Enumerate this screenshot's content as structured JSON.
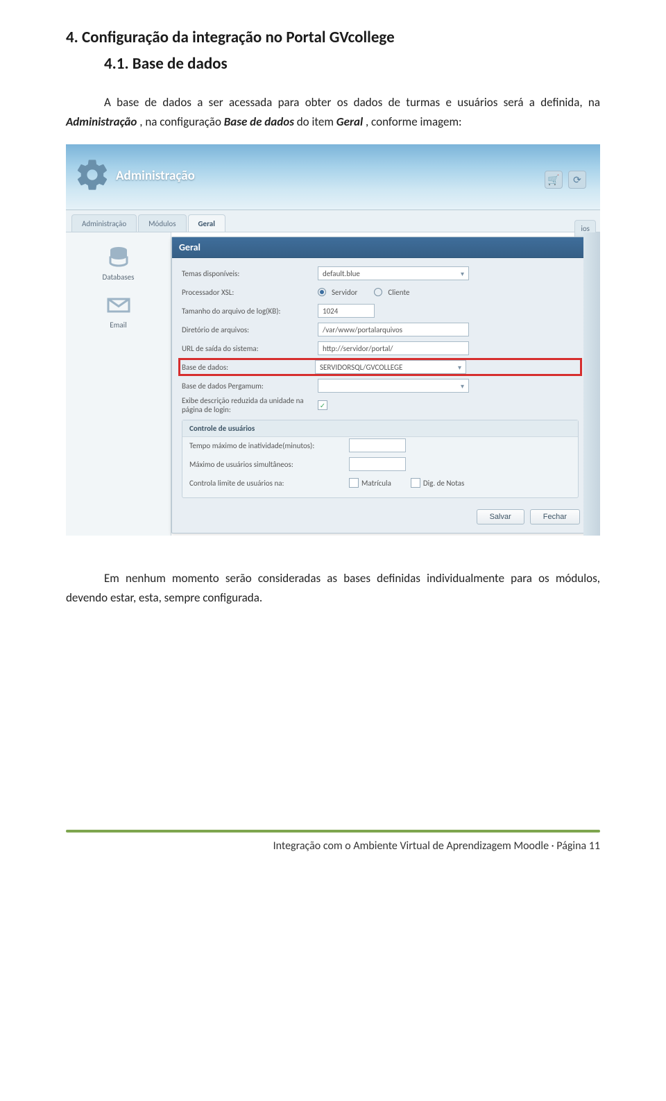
{
  "doc": {
    "h1": "4. Configuração da integração no Portal GVcollege",
    "h2": "4.1. Base de dados",
    "p1_a": "A base de dados a ser acessada para obter os dados de turmas e usuários será a definida, na ",
    "p1_admin": "Administração",
    "p1_b": ", na configuração ",
    "p1_base": "Base de dados",
    "p1_c": " do item ",
    "p1_geral": "Geral",
    "p1_d": ", conforme imagem:",
    "p2": "Em nenhum momento serão consideradas as bases definidas individualmente para os módulos, devendo estar, esta, sempre configurada.",
    "footer": "Integração com o Ambiente Virtual de Aprendizagem Moodle · Página 11"
  },
  "app": {
    "header_title": "Administração",
    "tabs": {
      "t1": "Administração",
      "t2": "Módulos",
      "t3": "Geral"
    },
    "side": {
      "s1": "Databases",
      "s2": "Email"
    },
    "right_tab": "ios",
    "panel_title": "Geral",
    "fields": {
      "temas": {
        "label": "Temas disponíveis:",
        "value": "default.blue"
      },
      "proc": {
        "label": "Processador XSL:"
      },
      "proc_r1": "Servidor",
      "proc_r2": "Cliente",
      "tam": {
        "label": "Tamanho do arquivo de log(KB):",
        "value": "1024"
      },
      "dir": {
        "label": "Diretório de arquivos:",
        "value": "/var/www/portalarquivos"
      },
      "url": {
        "label": "URL de saída do sistema:",
        "value": "http://servidor/portal/"
      },
      "base": {
        "label": "Base de dados:",
        "value": "SERVIDORSQL/GVCOLLEGE"
      },
      "basep": {
        "label": "Base de dados Pergamum:",
        "value": ""
      },
      "exibe": {
        "label": "Exibe descrição reduzida da unidade na página de login:"
      },
      "ctrl_title": "Controle de usuários",
      "tempo": {
        "label": "Tempo máximo de inatividade(minutos):"
      },
      "max": {
        "label": "Máximo de usuários simultâneos:"
      },
      "limite": {
        "label": "Controla limite de usuários na:"
      },
      "chk_mat": "Matrícula",
      "chk_dig": "Dig. de Notas"
    },
    "buttons": {
      "save": "Salvar",
      "close": "Fechar"
    }
  }
}
